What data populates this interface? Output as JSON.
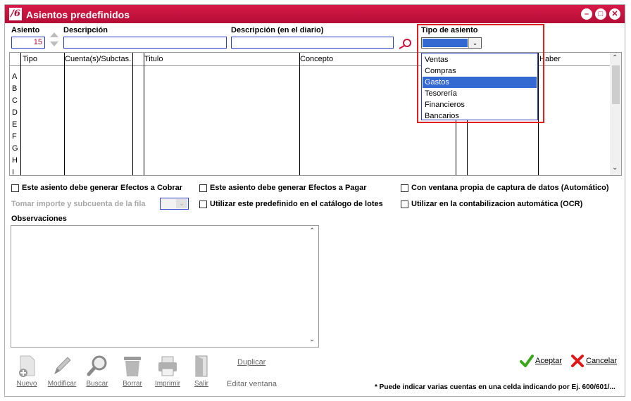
{
  "window": {
    "title": "Asientos predefinidos",
    "logo_text": "/6"
  },
  "header": {
    "asiento_label": "Asiento",
    "asiento_value": "15",
    "descripcion_label": "Descripción",
    "descripcion_value": "",
    "descripcion_diario_label": "Descripción (en el diario)",
    "descripcion_diario_value": "",
    "tipo_label": "Tipo de asiento",
    "tipo_value": ""
  },
  "tipo_options": [
    "Ventas",
    "Compras",
    "Gastos",
    "Tesorería",
    "Financieros",
    "Bancarios"
  ],
  "tipo_highlighted": "Gastos",
  "grid": {
    "columns": [
      "Tipo",
      "Cuenta(s)/Subctas.",
      "Titulo",
      "Concepto",
      "Haber"
    ],
    "rows": [
      "A",
      "B",
      "C",
      "D",
      "E",
      "F",
      "G",
      "H",
      "I"
    ]
  },
  "options": {
    "cobrar": "Este asiento debe generar Efectos a Cobrar",
    "pagar": "Este asiento debe generar Efectos a Pagar",
    "ventana": "Con ventana propia de captura de datos (Automático)",
    "tomar": "Tomar importe y subcuenta de la fila",
    "lotes": "Utilizar este predefinido en el catálogo de lotes",
    "ocr": "Utilizar en la contabilizacion automática (OCR)"
  },
  "observaciones_label": "Observaciones",
  "toolbar": {
    "nuevo": "Nuevo",
    "modificar": "Modificar",
    "buscar": "Buscar",
    "borrar": "Borrar",
    "imprimir": "Imprimir",
    "salir": "Salir",
    "duplicar": "Duplicar",
    "editar_ventana": "Editar ventana"
  },
  "actions": {
    "aceptar": "Aceptar",
    "cancelar": "Cancelar"
  },
  "footnote": "* Puede indicar varias cuentas en una celda indicando por Ej. 600/601/...",
  "colors": {
    "title_bar": "#c8143f",
    "field_border": "#2d3cc8",
    "highlight": "#3369d0",
    "annotation": "#e02020"
  }
}
